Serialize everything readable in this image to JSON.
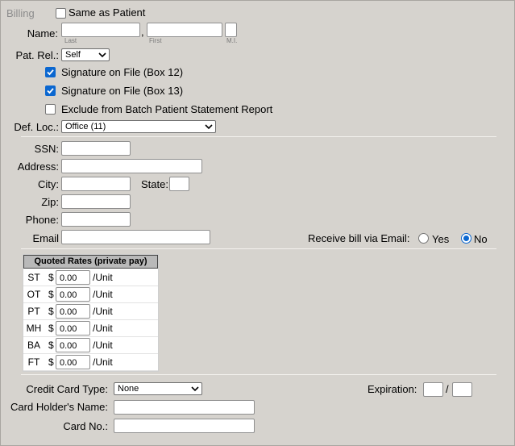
{
  "billing": {
    "section_label": "Billing",
    "same_as_patient_label": "Same as Patient",
    "same_as_patient_checked": false,
    "name_label": "Name:",
    "name_last_caption": "Last",
    "name_first_caption": "First",
    "name_mi_caption": "M.I.",
    "name_separator": ",",
    "last_value": "",
    "first_value": "",
    "mi_value": "",
    "pat_rel_label": "Pat. Rel.:",
    "pat_rel_value": "Self",
    "sig_box12_label": "Signature on File (Box 12)",
    "sig_box12_checked": true,
    "sig_box13_label": "Signature on File (Box 13)",
    "sig_box13_checked": true,
    "exclude_label": "Exclude from Batch Patient Statement Report",
    "exclude_checked": false,
    "def_loc_label": "Def. Loc.:",
    "def_loc_value": "Office (11)"
  },
  "contact": {
    "ssn_label": "SSN:",
    "address_label": "Address:",
    "city_label": "City:",
    "state_label": "State:",
    "zip_label": "Zip:",
    "phone_label": "Phone:",
    "email_label": "Email",
    "receive_bill_label": "Receive bill via Email:",
    "yes_label": "Yes",
    "no_label": "No",
    "receive_bill_value": "No"
  },
  "rates": {
    "header": "Quoted Rates (private pay)",
    "currency": "$",
    "unit_label": "/Unit",
    "rows": [
      {
        "code": "ST",
        "value": "0.00"
      },
      {
        "code": "OT",
        "value": "0.00"
      },
      {
        "code": "PT",
        "value": "0.00"
      },
      {
        "code": "MH",
        "value": "0.00"
      },
      {
        "code": "BA",
        "value": "0.00"
      },
      {
        "code": "FT",
        "value": "0.00"
      }
    ]
  },
  "card": {
    "type_label": "Credit Card Type:",
    "type_value": "None",
    "expiration_label": "Expiration:",
    "expiration_separator": "/",
    "holder_label": "Card Holder's Name:",
    "number_label": "Card No.:"
  },
  "colors": {
    "panel_bg": "#d6d3ce",
    "accent": "#0b67d0",
    "header_bg": "#b9b9b9"
  }
}
